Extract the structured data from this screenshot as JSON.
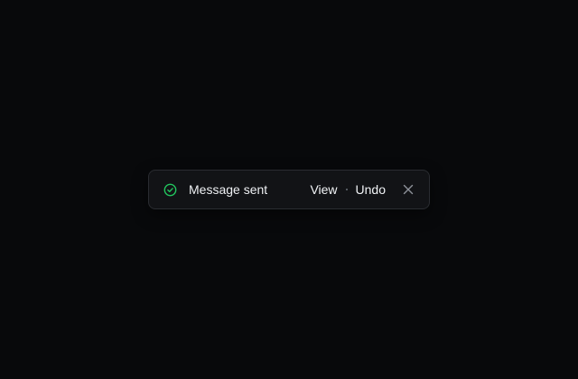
{
  "toast": {
    "icon": "check-circle-icon",
    "message": "Message sent",
    "actions": {
      "view_label": "View",
      "undo_label": "Undo"
    },
    "close_icon": "close-icon",
    "status_color": "#22c55e",
    "background": "#121316",
    "border_color": "#2a2c31"
  }
}
